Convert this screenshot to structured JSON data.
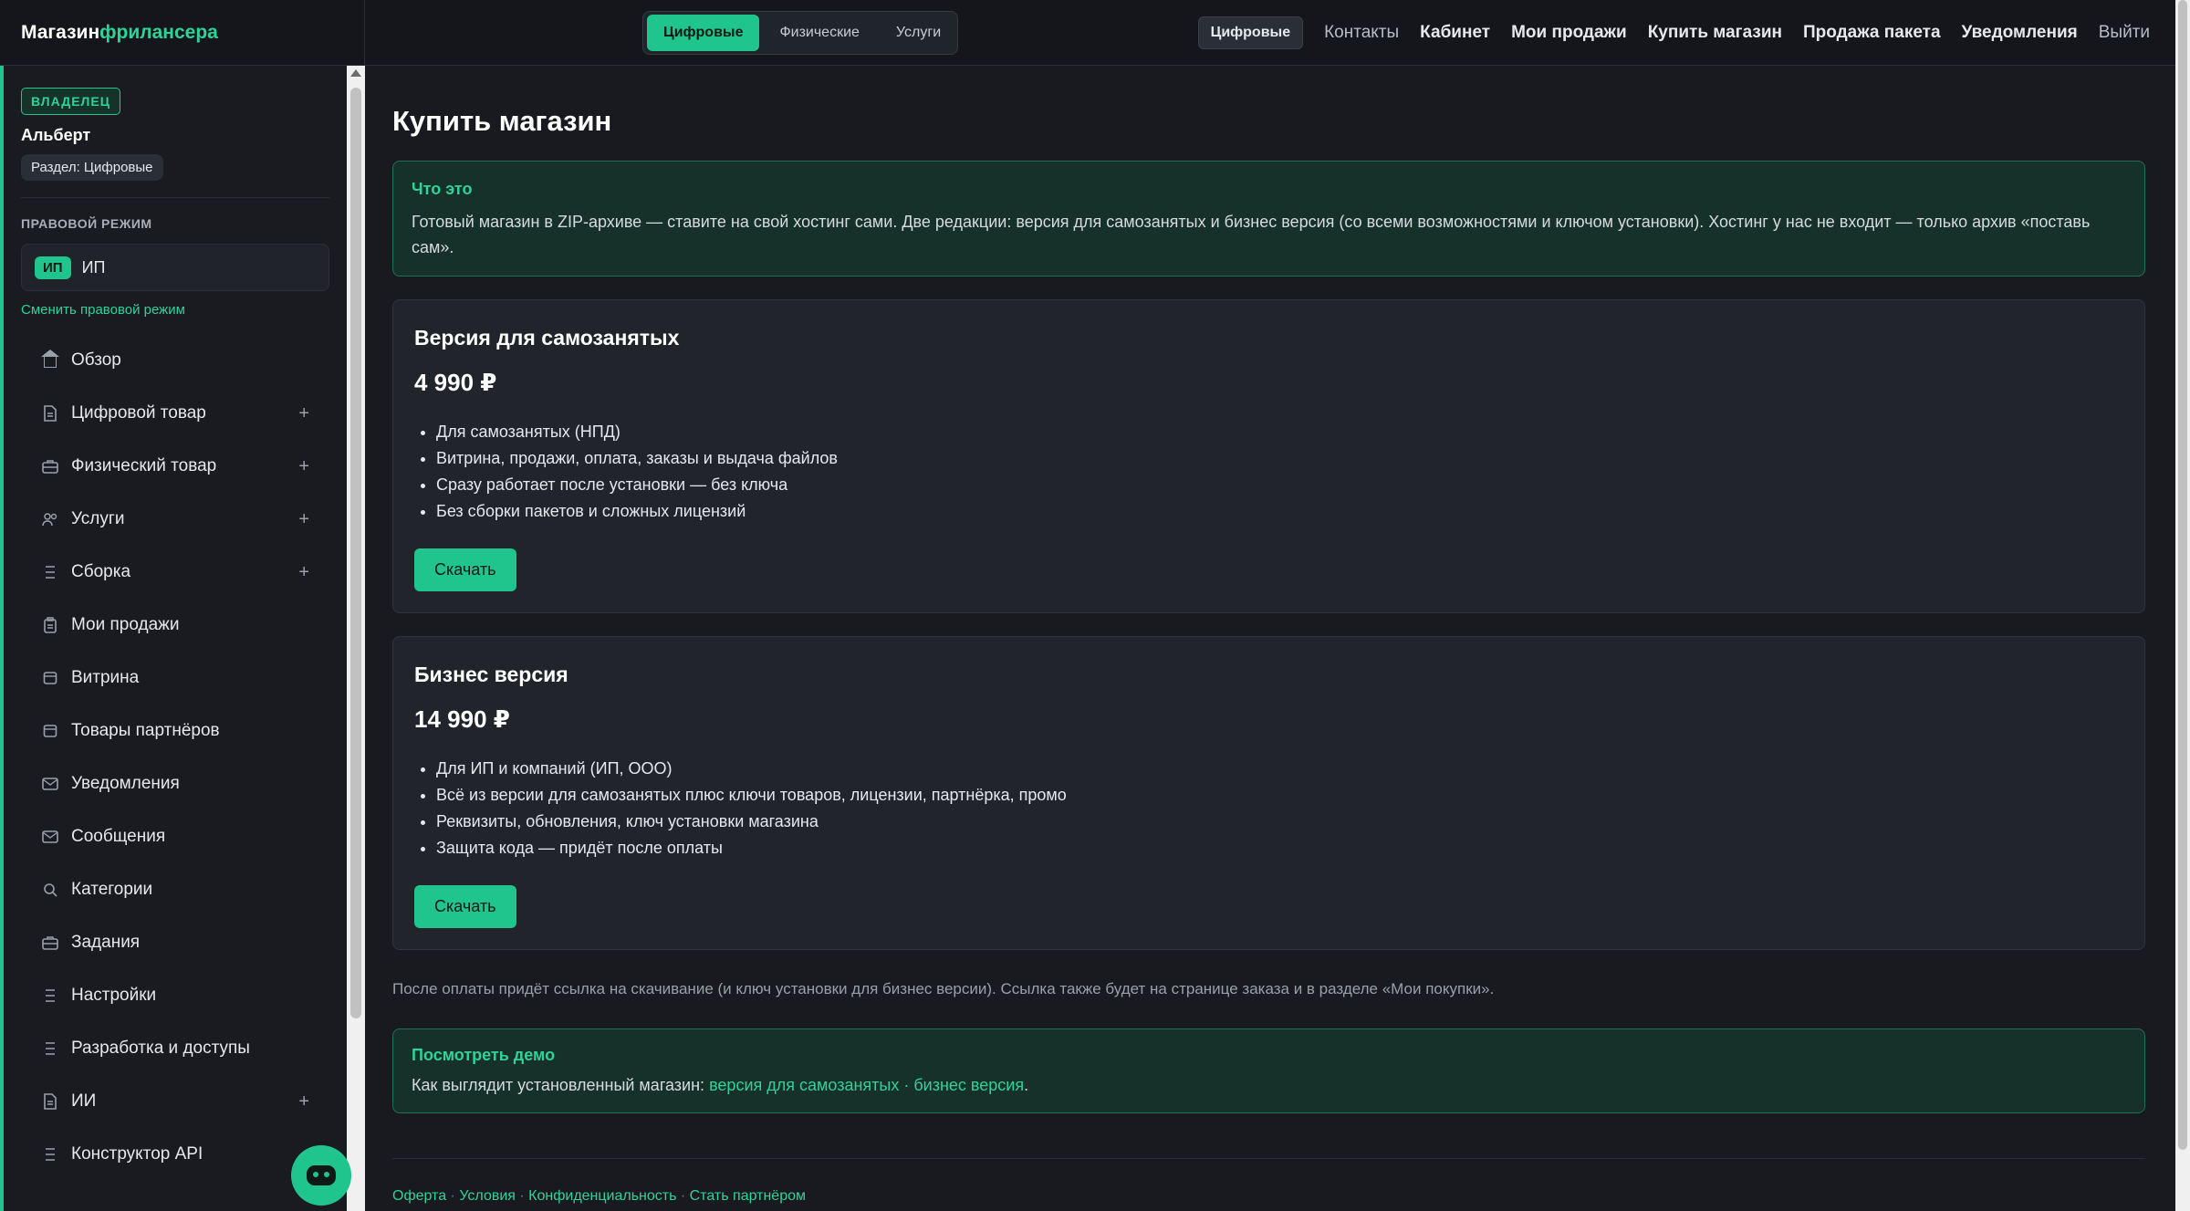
{
  "brand": {
    "part1": "Магазин",
    "part2": "фрилансера"
  },
  "segments": [
    {
      "label": "Цифровые",
      "active": true
    },
    {
      "label": "Физические",
      "active": false
    },
    {
      "label": "Услуги",
      "active": false
    }
  ],
  "topnav": {
    "pill": "Цифровые",
    "contacts": "Контакты",
    "cabinet": "Кабинет",
    "my_sales": "Мои продажи",
    "buy_shop": "Купить магазин",
    "sell_package": "Продажа пакета",
    "notifications": "Уведомления",
    "logout": "Выйти"
  },
  "sidebar": {
    "role": "ВЛАДЕЛЕЦ",
    "user_name": "Альберт",
    "section_chip": "Раздел: Цифровые",
    "legal_label": "ПРАВОВОЙ РЕЖИМ",
    "regime_chip": "ИП",
    "regime_text": "ИП",
    "change_regime": "Сменить правовой режим",
    "items": [
      {
        "label": "Обзор",
        "icon": "home-icon",
        "plus": false
      },
      {
        "label": "Цифровой товар",
        "icon": "document-icon",
        "plus": true
      },
      {
        "label": "Физический товар",
        "icon": "briefcase-icon",
        "plus": true
      },
      {
        "label": "Услуги",
        "icon": "users-icon",
        "plus": true
      },
      {
        "label": "Сборка",
        "icon": "list-icon",
        "plus": true
      },
      {
        "label": "Мои продажи",
        "icon": "clipboard-icon",
        "plus": false
      },
      {
        "label": "Витрина",
        "icon": "storefront-icon",
        "plus": false
      },
      {
        "label": "Товары партнёров",
        "icon": "storefront-icon",
        "plus": false
      },
      {
        "label": "Уведомления",
        "icon": "mail-icon",
        "plus": false
      },
      {
        "label": "Сообщения",
        "icon": "mail-icon",
        "plus": false
      },
      {
        "label": "Категории",
        "icon": "search-icon",
        "plus": false
      },
      {
        "label": "Задания",
        "icon": "briefcase-icon",
        "plus": false
      },
      {
        "label": "Настройки",
        "icon": "list-icon",
        "plus": false
      },
      {
        "label": "Разработка и доступы",
        "icon": "list-icon",
        "plus": false
      },
      {
        "label": "ИИ",
        "icon": "document-icon",
        "plus": true
      },
      {
        "label": "Конструктор API",
        "icon": "list-icon",
        "plus": false
      }
    ],
    "plus_symbol": "+"
  },
  "main": {
    "title": "Купить магазин",
    "info": {
      "heading": "Что это",
      "text": "Готовый магазин в ZIP-архиве — ставите на свой хостинг сами. Две редакции: версия для самозанятых и бизнес версия (со всеми возможностями и ключом установки). Хостинг у нас не входит — только архив «поставь сам»."
    },
    "plans": [
      {
        "title": "Версия для самозанятых",
        "price": "4 990 ₽",
        "features": [
          "Для самозанятых (НПД)",
          "Витрина, продажи, оплата, заказы и выдача файлов",
          "Сразу работает после установки — без ключа",
          "Без сборки пакетов и сложных лицензий"
        ],
        "button": "Скачать"
      },
      {
        "title": "Бизнес версия",
        "price": "14 990 ₽",
        "features": [
          "Для ИП и компаний (ИП, ООО)",
          "Всё из версии для самозанятых плюс ключи товаров, лицензии, партнёрка, промо",
          "Реквизиты, обновления, ключ установки магазина",
          "Защита кода — придёт после оплаты"
        ],
        "button": "Скачать"
      }
    ],
    "note": "После оплаты придёт ссылка на скачивание (и ключ установки для бизнес версии). Ссылка также будет на странице заказа и в разделе «Мои покупки».",
    "demo": {
      "heading": "Посмотреть демо",
      "prefix": "Как выглядит установленный магазин: ",
      "link1": "версия для самозанятых",
      "sep": " · ",
      "link2": "бизнес версия",
      "suffix": "."
    },
    "footer": {
      "links": [
        "Оферта",
        "Условия",
        "Конфиденциальность",
        "Стать партнёром"
      ],
      "sep": " · "
    }
  },
  "colors": {
    "accent": "#1fc58d",
    "background": "#181a20",
    "card": "#21242b"
  }
}
